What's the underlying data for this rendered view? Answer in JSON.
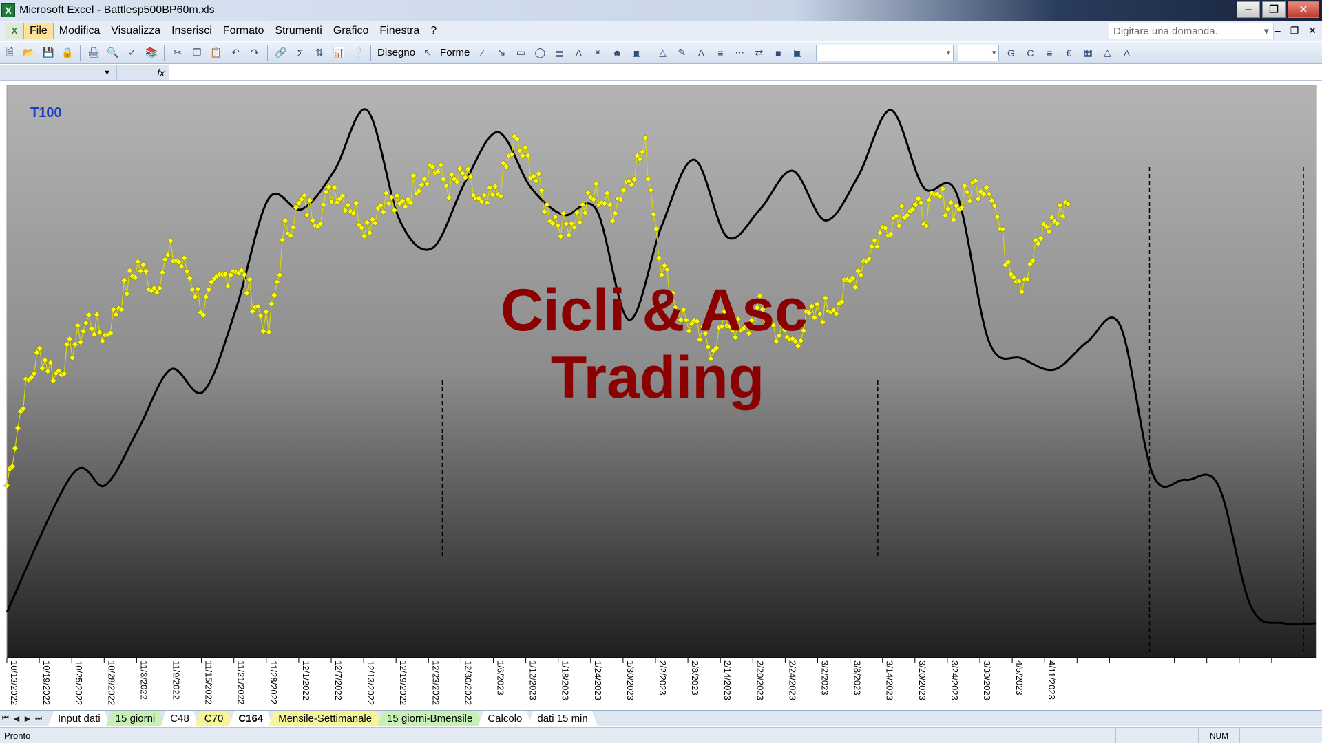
{
  "window": {
    "app_icon": "excel-icon",
    "title": "Microsoft Excel - Battlesp500BP60m.xls",
    "buttons": [
      "minimize-icon",
      "restore-icon",
      "close-icon"
    ]
  },
  "menu": {
    "items": [
      "File",
      "Modifica",
      "Visualizza",
      "Inserisci",
      "Formato",
      "Strumenti",
      "Grafico",
      "Finestra",
      "?"
    ],
    "ask_placeholder": "Digitare una domanda."
  },
  "toolbar": {
    "disegno_label": "Disegno",
    "forme_label": "Forme"
  },
  "formula": {
    "fx_label": "fx"
  },
  "chart_data": {
    "type": "line",
    "corner_label": "T100",
    "watermark_line1": "Cicli & Asc",
    "watermark_line2": "Trading",
    "x_tick_labels": [
      "10/13/2022",
      "10/19/2022",
      "10/25/2022",
      "10/28/2022",
      "11/3/2022",
      "11/9/2022",
      "11/15/2022",
      "11/21/2022",
      "11/28/2022",
      "12/1/2022",
      "12/7/2022",
      "12/13/2022",
      "12/19/2022",
      "12/23/2022",
      "12/30/2022",
      "1/6/2023",
      "1/12/2023",
      "1/18/2023",
      "1/24/2023",
      "1/30/2023",
      "2/2/2023",
      "2/8/2023",
      "2/14/2023",
      "2/20/2023",
      "2/24/2023",
      "3/2/2023",
      "3/8/2023",
      "3/14/2023",
      "3/20/2023",
      "3/24/2023",
      "3/30/2023",
      "4/5/2023",
      "4/11/2023"
    ],
    "grid": false,
    "legend": "none",
    "colors": {
      "price_marker": "#ffff00",
      "price_line": "#d8d800",
      "cycle_line": "#000000",
      "watermark": "#8b0000",
      "corner_label": "#1f3fbf"
    },
    "series": [
      {
        "style": "yellow-markers",
        "x": [
          0,
          0.5,
          1,
          1.5,
          2,
          2.5,
          3,
          3.5,
          4,
          4.5,
          5,
          5.5,
          6,
          6.5,
          7,
          7.5,
          8,
          8.5,
          9,
          9.5,
          10,
          10.5,
          11,
          11.5,
          12,
          12.5,
          13,
          13.5,
          14,
          14.5,
          15,
          15.5,
          16,
          16.5,
          17,
          17.5,
          18,
          18.5,
          19,
          19.5,
          20,
          20.5,
          21,
          21.5,
          22,
          22.5,
          23,
          23.5,
          24,
          24.5,
          25,
          25.5,
          26,
          26.5,
          27,
          27.5,
          28,
          28.5,
          29,
          29.5,
          30,
          30.5,
          31,
          31.5,
          32,
          32.5
        ],
        "y": [
          0.3,
          0.46,
          0.54,
          0.5,
          0.55,
          0.6,
          0.57,
          0.64,
          0.7,
          0.66,
          0.72,
          0.69,
          0.62,
          0.67,
          0.7,
          0.64,
          0.58,
          0.76,
          0.81,
          0.79,
          0.84,
          0.81,
          0.77,
          0.82,
          0.8,
          0.85,
          0.88,
          0.84,
          0.86,
          0.8,
          0.83,
          0.92,
          0.88,
          0.8,
          0.77,
          0.79,
          0.83,
          0.8,
          0.86,
          0.91,
          0.7,
          0.62,
          0.58,
          0.55,
          0.6,
          0.57,
          0.62,
          0.58,
          0.56,
          0.6,
          0.62,
          0.64,
          0.69,
          0.74,
          0.78,
          0.81,
          0.79,
          0.82,
          0.8,
          0.84,
          0.85,
          0.72,
          0.67,
          0.74,
          0.78,
          0.82
        ],
        "note_y_scale": "normalized chart height 0 bottom to 1 top"
      },
      {
        "style": "black-line",
        "x": [
          0,
          2,
          3,
          4,
          5,
          6,
          7,
          8,
          9,
          10,
          11,
          12,
          13,
          14,
          15,
          16,
          17,
          18,
          19,
          20,
          21,
          22,
          23,
          24,
          25,
          26,
          27,
          28,
          29,
          30,
          31,
          32,
          33,
          34,
          35,
          36,
          37,
          38,
          39,
          40
        ],
        "y": [
          0.07,
          0.32,
          0.3,
          0.4,
          0.51,
          0.47,
          0.62,
          0.82,
          0.8,
          0.87,
          0.98,
          0.78,
          0.73,
          0.85,
          0.94,
          0.84,
          0.79,
          0.8,
          0.6,
          0.77,
          0.89,
          0.75,
          0.8,
          0.87,
          0.78,
          0.86,
          0.98,
          0.84,
          0.83,
          0.56,
          0.53,
          0.51,
          0.56,
          0.59,
          0.32,
          0.31,
          0.3,
          0.08,
          0.05,
          0.05
        ]
      }
    ],
    "dashed_markers_x": [
      13.3,
      26.6,
      34.9,
      39.6
    ]
  },
  "sheet_tabs": [
    {
      "label": "Input dati",
      "style": "white"
    },
    {
      "label": "15 giorni",
      "style": "green"
    },
    {
      "label": "C48",
      "style": "white"
    },
    {
      "label": "C70",
      "style": "yellow"
    },
    {
      "label": "C164",
      "style": "active"
    },
    {
      "label": "Mensile-Settimanale",
      "style": "yellow"
    },
    {
      "label": "15 giorni-Bmensile",
      "style": "green"
    },
    {
      "label": "Calcolo",
      "style": "white"
    },
    {
      "label": "dati 15 min",
      "style": "white"
    }
  ],
  "status": {
    "left_text": "Pronto",
    "num_indicator": "NUM"
  }
}
